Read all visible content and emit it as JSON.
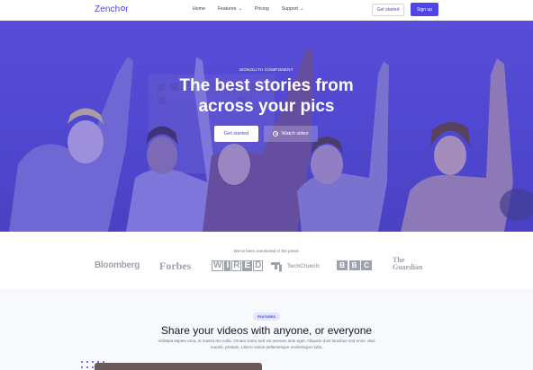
{
  "nav": {
    "logo_text_a": "Zench",
    "logo_text_b": "r",
    "links": [
      "Home",
      "Features",
      "Pricing",
      "Support"
    ],
    "get_started": "Get started",
    "sign_up": "Sign up"
  },
  "hero": {
    "eyebrow": "MONOLITH COMPONENT",
    "title_line1": "The best stories from",
    "title_line2": "across your pics",
    "primary_button": "Get started",
    "secondary_button": "Watch video",
    "overlay_color": "#4f46e5"
  },
  "press": {
    "label": "We've been mentioned in the press:",
    "logos": {
      "bloomberg": "Bloomberg",
      "forbes": "Forbes",
      "wired": [
        "W",
        "I",
        "R",
        "E",
        "D"
      ],
      "techcrunch": "TechCrunch",
      "bbc": [
        "B",
        "B",
        "C"
      ],
      "guardian_line1": "The",
      "guardian_line2": "Guardian"
    }
  },
  "features": {
    "badge": "FEATURES",
    "title": "Share your videos with anyone, or everyone",
    "description": "Volutpat sapien urna, in massa leo nulla. Ornare tortor sed est aenean ante eget. Aliquam duis faucibus sed enim, duis mauris, pretium. Libero varius pellentesque scelerisque nulla."
  },
  "colors": {
    "accent": "#4f46e5",
    "press_logo": "#9ca3af"
  }
}
